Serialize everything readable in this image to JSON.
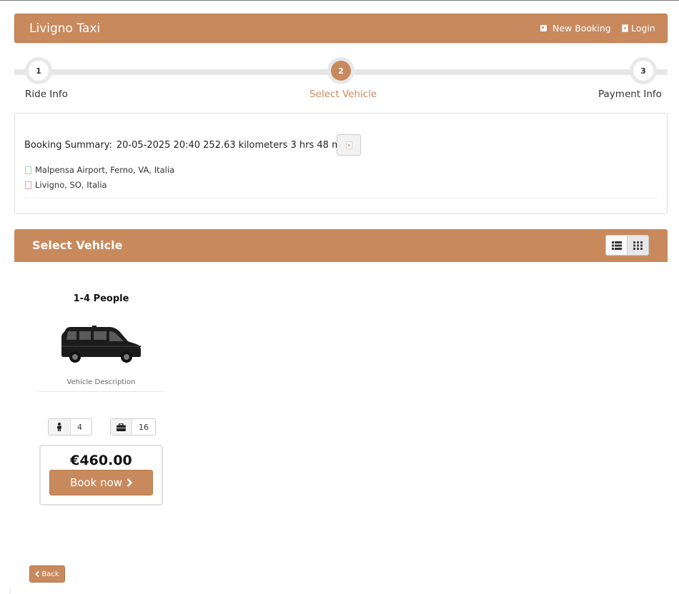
{
  "navbar": {
    "brand": "Livigno Taxi",
    "new_booking": "New Booking",
    "login": "Login"
  },
  "steps": [
    {
      "number": "1",
      "label": "Ride Info"
    },
    {
      "number": "2",
      "label": "Select Vehicle"
    },
    {
      "number": "3",
      "label": "Payment Info"
    }
  ],
  "summary": {
    "label": "Booking Summary:",
    "datetime": "20-05-2025 20:40",
    "distance": "252.63 kilometers",
    "duration": "3 hrs 48 mins",
    "pickup": "Malpensa Airport, Ferno, VA, Italia",
    "dropoff": "Livigno, SO, Italia"
  },
  "vehicles_section": {
    "title": "Select Vehicle"
  },
  "vehicle": {
    "title": "1-4 People",
    "description": "Vehicle Description",
    "passengers": "4",
    "luggage": "16",
    "price": "€460.00",
    "book_label": "Book now"
  },
  "back_label": "Back",
  "colors": {
    "accent": "#c8895d"
  }
}
